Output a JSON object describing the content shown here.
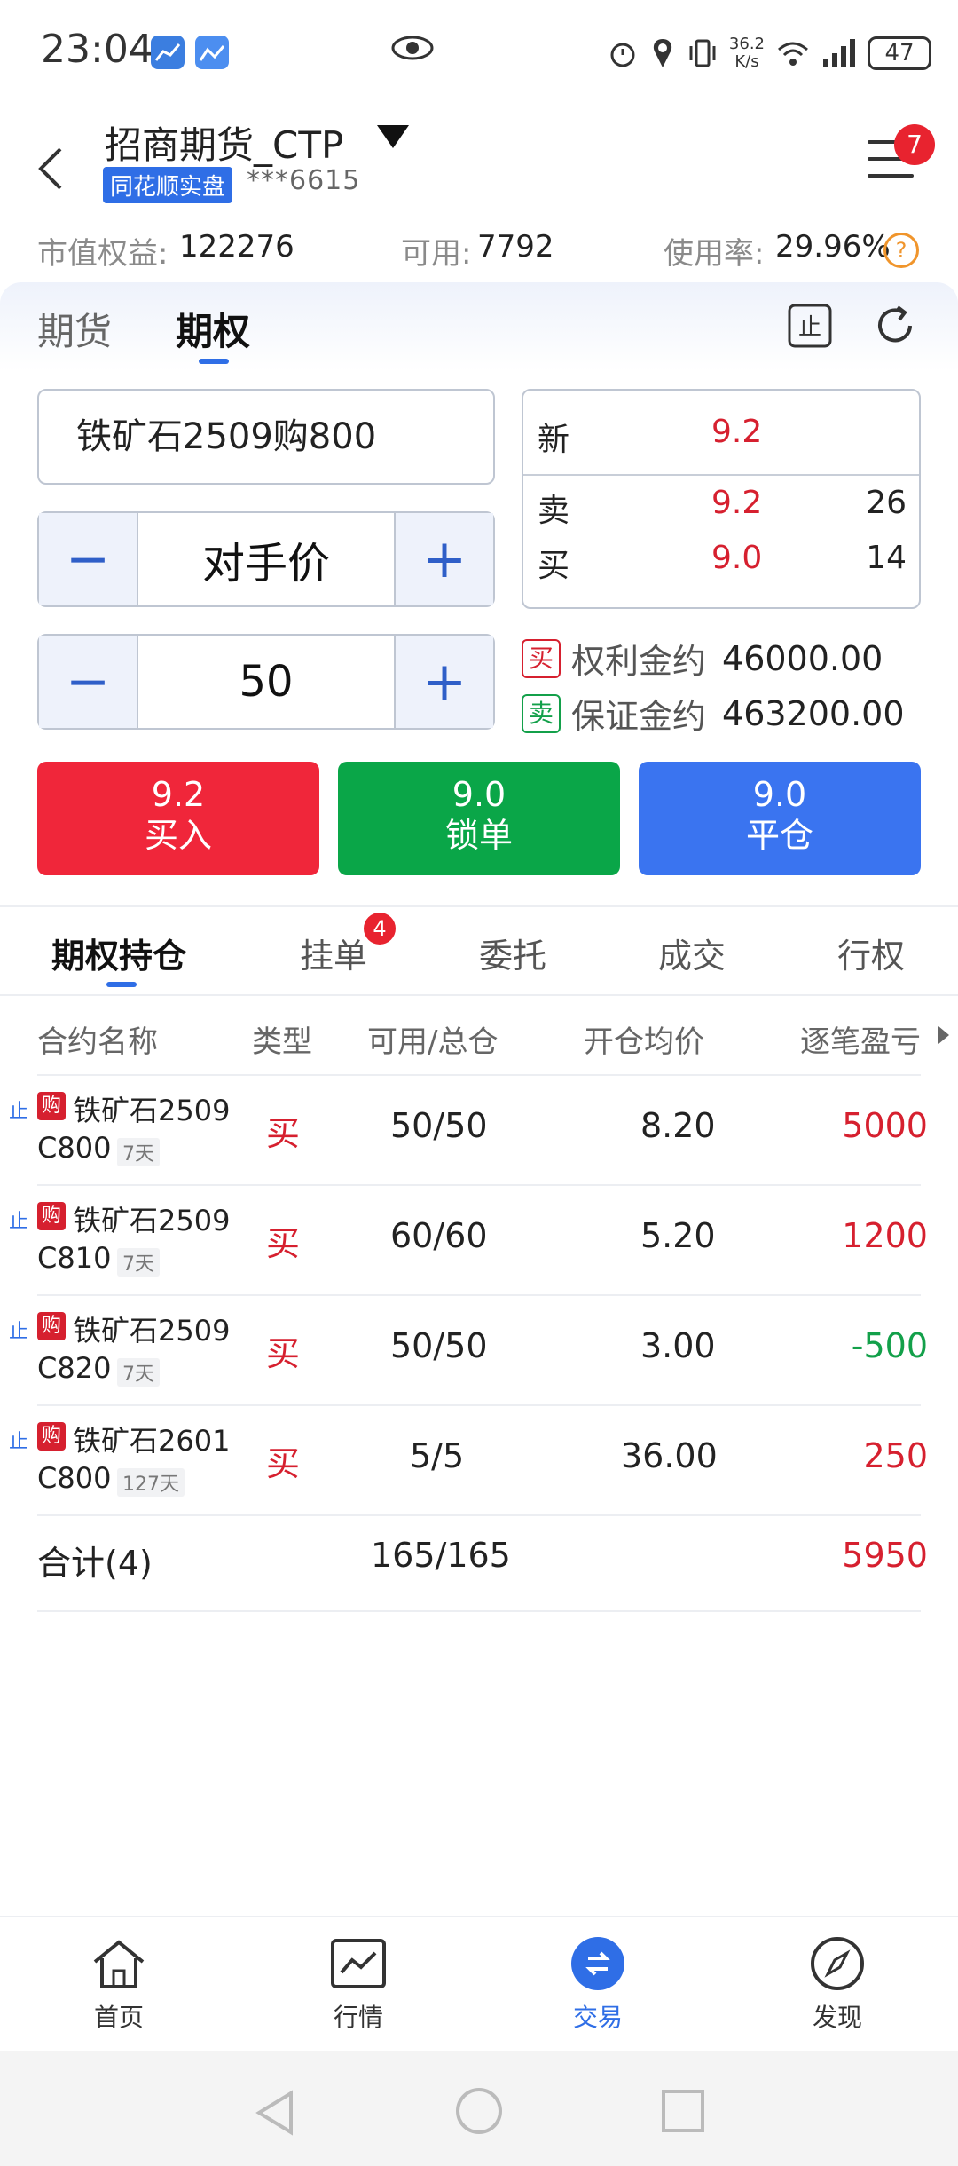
{
  "status": {
    "time": "23:04",
    "net_speed": "36.2",
    "net_unit": "K/s",
    "net_gen": "6",
    "battery": "47"
  },
  "header": {
    "account_name": "招商期货_CTP",
    "tag": "同花顺实盘",
    "account_no": "***6615",
    "menu_badge": "7"
  },
  "summary": {
    "equity_label": "市值权益:",
    "equity_value": "122276",
    "available_label": "可用:",
    "available_value": "7792",
    "usage_label": "使用率:",
    "usage_value": "29.96%",
    "help": "?"
  },
  "tabs": {
    "futures": "期货",
    "options": "期权",
    "stop_icon_text": "止"
  },
  "order": {
    "contract": "铁矿石2509购800",
    "price_mode": "对手价",
    "quantity": "50",
    "minus": "−",
    "plus": "+"
  },
  "quote": {
    "last_label": "新",
    "last_price": "9.2",
    "ask_label": "卖",
    "ask_price": "9.2",
    "ask_vol": "26",
    "bid_label": "买",
    "bid_price": "9.0",
    "bid_vol": "14"
  },
  "margin": {
    "buy_tag": "买",
    "premium_label": "权利金约",
    "premium_value": "46000.00",
    "sell_tag": "卖",
    "deposit_label": "保证金约",
    "deposit_value": "463200.00"
  },
  "actions": [
    {
      "price": "9.2",
      "label": "买入",
      "color": "#f0263a"
    },
    {
      "price": "9.0",
      "label": "锁单",
      "color": "#0aa648"
    },
    {
      "price": "9.0",
      "label": "平仓",
      "color": "#3a74f0"
    }
  ],
  "position_tabs": {
    "holdings": "期权持仓",
    "pending": "挂单",
    "pending_badge": "4",
    "orders": "委托",
    "trades": "成交",
    "exercise": "行权"
  },
  "table": {
    "headers": [
      "合约名称",
      "类型",
      "可用/总仓",
      "开仓均价",
      "逐笔盈亏"
    ],
    "rows": [
      {
        "stop": "止",
        "gou": "购",
        "name1": "铁矿石2509",
        "name2": "C800",
        "days": "7天",
        "type": "买",
        "qty": "50/50",
        "avg": "8.20",
        "pnl": "5000",
        "pnl_sign": "pos"
      },
      {
        "stop": "止",
        "gou": "购",
        "name1": "铁矿石2509",
        "name2": "C810",
        "days": "7天",
        "type": "买",
        "qty": "60/60",
        "avg": "5.20",
        "pnl": "1200",
        "pnl_sign": "pos"
      },
      {
        "stop": "止",
        "gou": "购",
        "name1": "铁矿石2509",
        "name2": "C820",
        "days": "7天",
        "type": "买",
        "qty": "50/50",
        "avg": "3.00",
        "pnl": "-500",
        "pnl_sign": "neg"
      },
      {
        "stop": "止",
        "gou": "购",
        "name1": "铁矿石2601",
        "name2": "C800",
        "days": "127天",
        "type": "买",
        "qty": "5/5",
        "avg": "36.00",
        "pnl": "250",
        "pnl_sign": "pos"
      }
    ],
    "total_label": "合计(4)",
    "total_qty": "165/165",
    "total_pnl": "5950"
  },
  "nav": {
    "home": "首页",
    "market": "行情",
    "trade": "交易",
    "discover": "发现"
  }
}
